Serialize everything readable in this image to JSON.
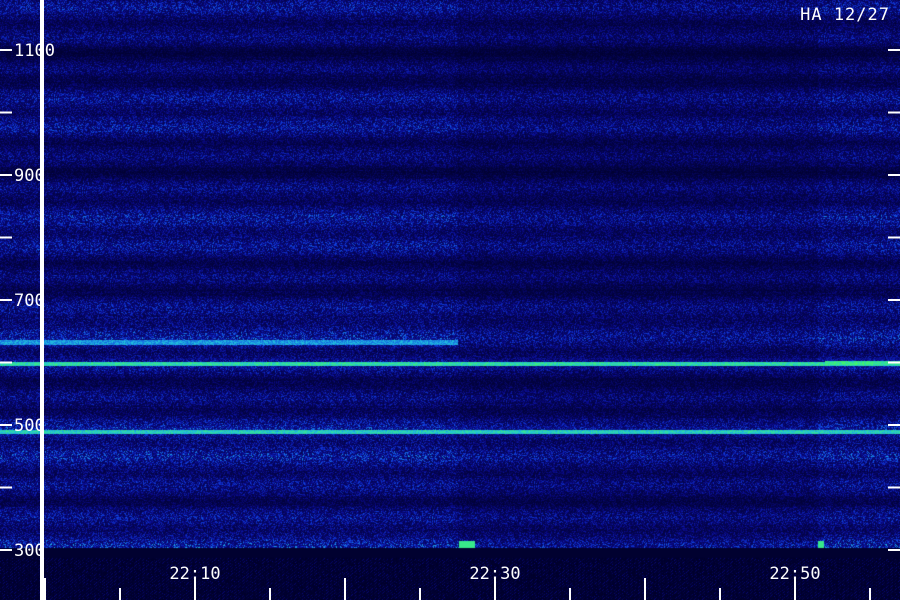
{
  "chart_data": {
    "type": "heatmap",
    "title": "",
    "corner_label": "HA 12/27",
    "xlabel": "",
    "ylabel": "",
    "x_tick_labels": [
      "22:10",
      "22:30",
      "22:50"
    ],
    "x_label_minutes": [
      10,
      30,
      50
    ],
    "x_major_minutes": [
      0,
      10,
      20,
      30,
      40,
      50,
      60
    ],
    "x_minor_minutes": [
      5,
      15,
      25,
      35,
      45,
      55
    ],
    "xlim_minutes": [
      -3,
      57
    ],
    "y_tick_labels": [
      300,
      500,
      700,
      900,
      1100
    ],
    "y_ticks": [
      300,
      400,
      500,
      600,
      700,
      800,
      900,
      1000,
      1100
    ],
    "ylim": [
      220,
      1180
    ],
    "marker_minute": -0.2,
    "gaps_minutes": [
      [
        27.6,
        28.6
      ],
      [
        51.5,
        51.9
      ]
    ],
    "bright_lines": [
      {
        "y": 633,
        "start_minute": -3,
        "end_minute": 27.5,
        "level": 0.75
      },
      {
        "y": 598,
        "start_minute": -3,
        "end_minute": 57,
        "level": 0.95
      },
      {
        "y": 490,
        "start_minute": -3,
        "end_minute": 57,
        "level": 0.9
      },
      {
        "y": 600,
        "start_minute": 52,
        "end_minute": 57,
        "level": 1.0
      }
    ],
    "colors": {
      "background": "#00003a",
      "low": "#0a0a8c",
      "mid": "#1040e0",
      "high": "#20c0e0",
      "peak": "#40ff60",
      "marker": "#ffffff"
    }
  }
}
